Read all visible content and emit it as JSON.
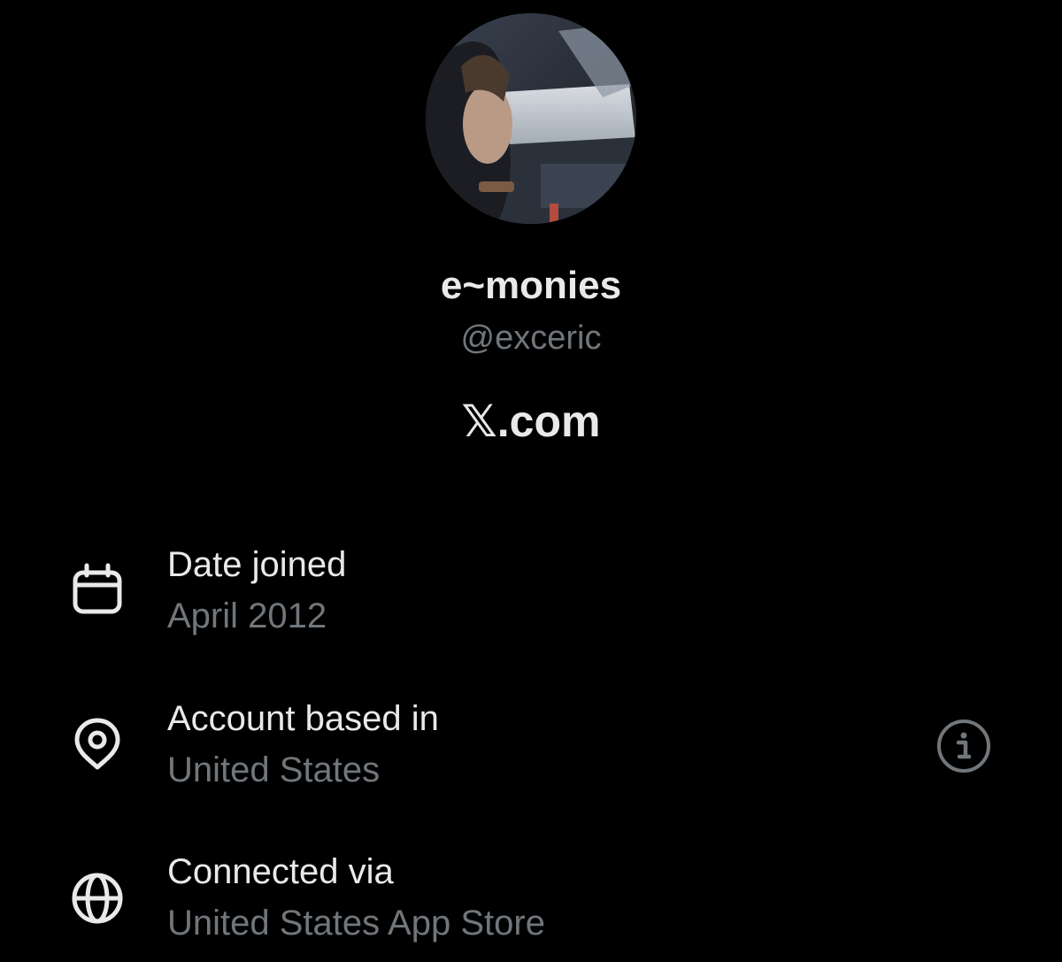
{
  "profile": {
    "display_name": "e~monies",
    "handle": "@exceric",
    "site": "𝕏.com"
  },
  "details": {
    "date_joined": {
      "label": "Date joined",
      "value": "April 2012",
      "icon": "calendar-icon"
    },
    "account_based_in": {
      "label": "Account based in",
      "value": "United States",
      "icon": "location-pin-icon",
      "action_icon": "info-icon"
    },
    "connected_via": {
      "label": "Connected via",
      "value": "United States App Store",
      "icon": "globe-icon"
    }
  },
  "colors": {
    "background": "#000000",
    "primary_text": "#e7e9ea",
    "secondary_text": "#71767b"
  }
}
